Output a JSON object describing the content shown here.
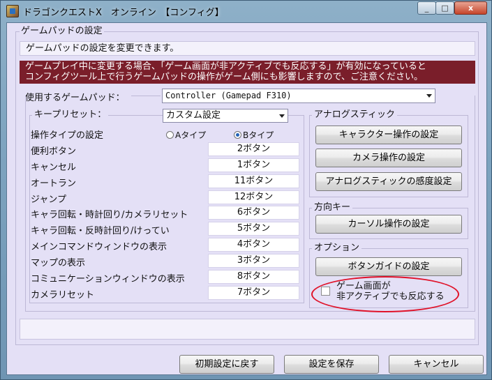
{
  "window": {
    "title": "ドラゴンクエストX　オンライン　【コンフィグ】",
    "min_label": "_",
    "max_label": "□",
    "close_label": "x"
  },
  "gamepad_settings": {
    "group_title": "ゲームパッドの設定",
    "description": "ゲームパッドの設定を変更できます。",
    "warning_line1": "ゲームプレイ中に変更する場合、「ゲーム画面が非アクティブでも反応する」が有効になっていると",
    "warning_line2": "コンフィグツール上で行うゲームパッドの操作がゲーム側にも影響しますので、ご注意ください。",
    "gamepad_label": "使用するゲームパッド：",
    "gamepad_value": "Controller (Gamepad F310)"
  },
  "key_preset": {
    "label": "キープリセット：",
    "value": "カスタム設定",
    "operation_type_label": "操作タイプの設定",
    "type_a": "Aタイプ",
    "type_b": "Bタイプ",
    "selected_type": "B",
    "rows": [
      {
        "label": "便利ボタン",
        "value": "2ボタン"
      },
      {
        "label": "キャンセル",
        "value": "1ボタン"
      },
      {
        "label": "オートラン",
        "value": "11ボタン"
      },
      {
        "label": "ジャンプ",
        "value": "12ボタン"
      },
      {
        "label": "キャラ回転・時計回り/カメラリセット",
        "value": "6ボタン"
      },
      {
        "label": "キャラ回転・反時計回り/けってい",
        "value": "5ボタン"
      },
      {
        "label": "メインコマンドウィンドウの表示",
        "value": "4ボタン"
      },
      {
        "label": "マップの表示",
        "value": "3ボタン"
      },
      {
        "label": "コミュニケーションウィンドウの表示",
        "value": "8ボタン"
      },
      {
        "label": "カメラリセット",
        "value": "7ボタン"
      }
    ]
  },
  "analog_stick": {
    "title": "アナログスティック",
    "character_button": "キャラクター操作の設定",
    "camera_button": "カメラ操作の設定",
    "sensitivity_button": "アナログスティックの感度設定"
  },
  "direction_keys": {
    "title": "方向キー",
    "cursor_button": "カーソル操作の設定"
  },
  "options": {
    "title": "オプション",
    "button_guide_button": "ボタンガイドの設定",
    "inactive_line1": "ゲーム画面が",
    "inactive_line2": "非アクティブでも反応する",
    "inactive_checked": false
  },
  "footer": {
    "reset_button": "初期設定に戻す",
    "save_button": "設定を保存",
    "cancel_button": "キャンセル"
  },
  "colors": {
    "warning_bg": "#7a1e2a",
    "client_bg": "#e4e0f6",
    "highlight_ellipse": "#e0132a"
  }
}
